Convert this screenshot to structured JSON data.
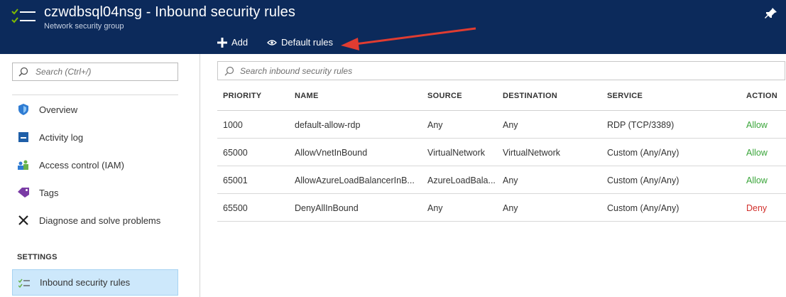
{
  "header": {
    "title": "czwdbsql04nsg - Inbound security rules",
    "subtitle": "Network security group",
    "icon": "nsg-list-icon",
    "pin_icon": "pin-icon"
  },
  "commands": {
    "add_label": "Add",
    "default_rules_label": "Default rules"
  },
  "sidebar": {
    "search_placeholder": "Search (Ctrl+/)",
    "items": [
      {
        "label": "Overview",
        "icon": "shield-icon"
      },
      {
        "label": "Activity log",
        "icon": "activity-log-icon"
      },
      {
        "label": "Access control (IAM)",
        "icon": "people-icon"
      },
      {
        "label": "Tags",
        "icon": "tag-icon"
      },
      {
        "label": "Diagnose and solve problems",
        "icon": "wrench-icon"
      }
    ],
    "settings_label": "SETTINGS",
    "settings_items": [
      {
        "label": "Inbound security rules",
        "icon": "inbound-rules-icon",
        "active": true
      }
    ]
  },
  "main": {
    "search_placeholder": "Search inbound security rules",
    "columns": {
      "priority": "PRIORITY",
      "name": "NAME",
      "source": "SOURCE",
      "destination": "DESTINATION",
      "service": "SERVICE",
      "action": "ACTION"
    },
    "rows": [
      {
        "priority": "1000",
        "name": "default-allow-rdp",
        "source": "Any",
        "destination": "Any",
        "service": "RDP (TCP/3389)",
        "action": "Allow"
      },
      {
        "priority": "65000",
        "name": "AllowVnetInBound",
        "source": "VirtualNetwork",
        "destination": "VirtualNetwork",
        "service": "Custom (Any/Any)",
        "action": "Allow"
      },
      {
        "priority": "65001",
        "name": "AllowAzureLoadBalancerInB...",
        "source": "AzureLoadBala...",
        "destination": "Any",
        "service": "Custom (Any/Any)",
        "action": "Allow"
      },
      {
        "priority": "65500",
        "name": "DenyAllInBound",
        "source": "Any",
        "destination": "Any",
        "service": "Custom (Any/Any)",
        "action": "Deny"
      }
    ]
  },
  "colors": {
    "header_bg": "#0c2a5b",
    "allow": "#3aa53a",
    "deny": "#d2302c",
    "active_item": "#cde8fb",
    "annotation_arrow": "#e03c31"
  }
}
